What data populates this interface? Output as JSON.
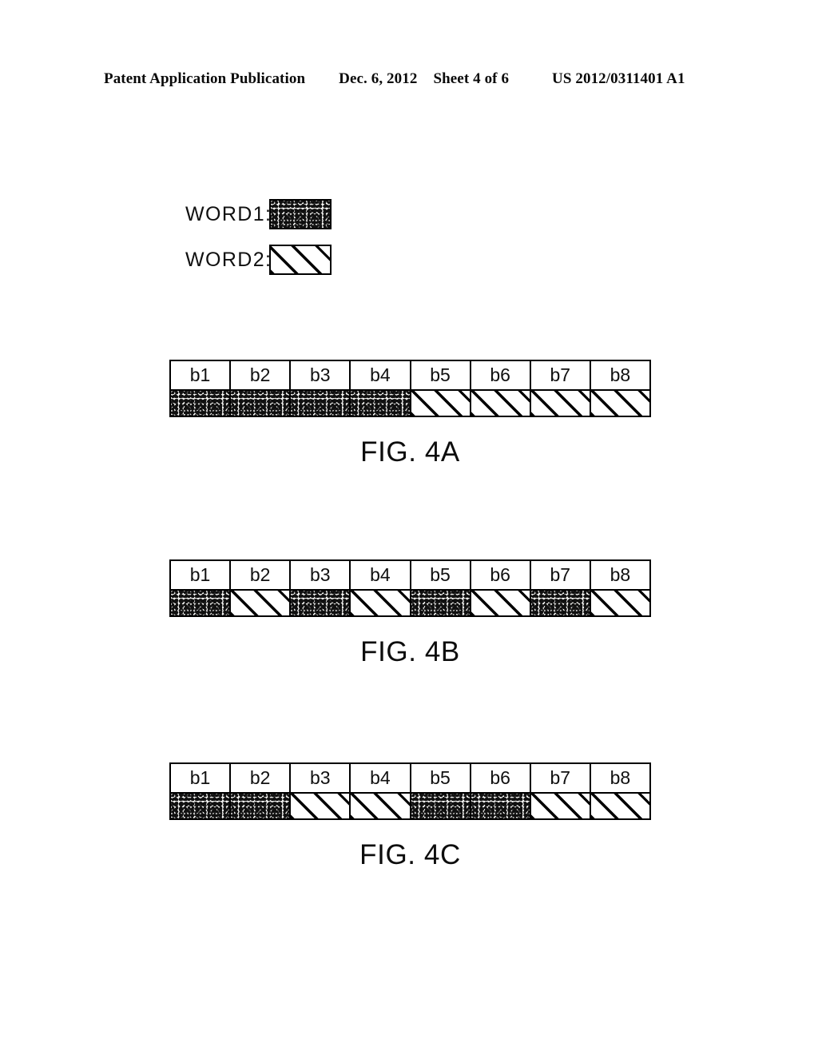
{
  "header": {
    "publication": "Patent Application Publication",
    "date": "Dec. 6, 2012",
    "sheet": "Sheet 4 of 6",
    "document_number": "US 2012/0311401 A1"
  },
  "legend": {
    "items": [
      {
        "label": "WORD1:",
        "pattern": "stipple",
        "swatch_name": "word1-swatch"
      },
      {
        "label": "WORD2:",
        "pattern": "hatch",
        "swatch_name": "word2-swatch"
      }
    ]
  },
  "figures": [
    {
      "id": "4A",
      "caption": "FIG. 4A",
      "bit_labels": [
        "b1",
        "b2",
        "b3",
        "b4",
        "b5",
        "b6",
        "b7",
        "b8"
      ],
      "bit_patterns": [
        "stipple",
        "stipple",
        "stipple",
        "stipple",
        "hatch",
        "hatch",
        "hatch",
        "hatch"
      ],
      "bit_words": [
        "WORD1",
        "WORD1",
        "WORD1",
        "WORD1",
        "WORD2",
        "WORD2",
        "WORD2",
        "WORD2"
      ]
    },
    {
      "id": "4B",
      "caption": "FIG. 4B",
      "bit_labels": [
        "b1",
        "b2",
        "b3",
        "b4",
        "b5",
        "b6",
        "b7",
        "b8"
      ],
      "bit_patterns": [
        "stipple",
        "hatch",
        "stipple",
        "hatch",
        "stipple",
        "hatch",
        "stipple",
        "hatch"
      ],
      "bit_words": [
        "WORD1",
        "WORD2",
        "WORD1",
        "WORD2",
        "WORD1",
        "WORD2",
        "WORD1",
        "WORD2"
      ]
    },
    {
      "id": "4C",
      "caption": "FIG. 4C",
      "bit_labels": [
        "b1",
        "b2",
        "b3",
        "b4",
        "b5",
        "b6",
        "b7",
        "b8"
      ],
      "bit_patterns": [
        "stipple",
        "stipple",
        "hatch",
        "hatch",
        "stipple",
        "stipple",
        "hatch",
        "hatch"
      ],
      "bit_words": [
        "WORD1",
        "WORD1",
        "WORD2",
        "WORD2",
        "WORD1",
        "WORD1",
        "WORD2",
        "WORD2"
      ]
    }
  ],
  "colors": {
    "ink": "#000000",
    "paper": "#ffffff",
    "stipple_base": "#f2f2f0"
  }
}
